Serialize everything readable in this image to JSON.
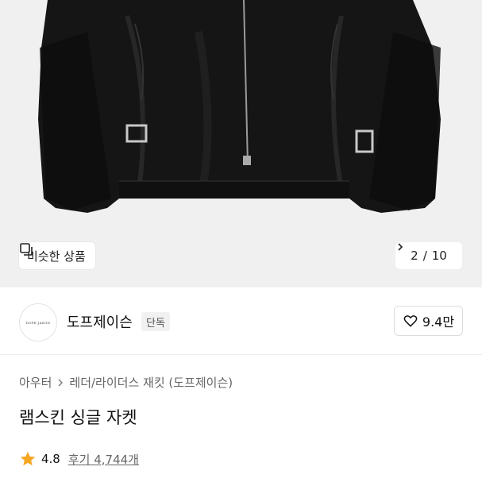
{
  "hero": {
    "similar_label": "비슷한 상품",
    "pager": {
      "current": "2",
      "separator": "/",
      "total": "10"
    }
  },
  "brand": {
    "logo_text": "DOPE JASON",
    "name": "도프제이슨",
    "badge": "단독",
    "like_count": "9.4만"
  },
  "product": {
    "breadcrumb": [
      "아우터",
      "레더/라이더스 재킷 (도프제이슨)"
    ],
    "title": "램스킨 싱글 자켓",
    "rating": "4.8",
    "reviews": "후기 4,744개"
  },
  "colors": {
    "star": "#f5a623",
    "hero_bg": "#f0f0f0",
    "jacket": "#151515"
  },
  "icons": [
    "copy-icon",
    "chevron-right-icon",
    "heart-icon",
    "star-icon"
  ]
}
